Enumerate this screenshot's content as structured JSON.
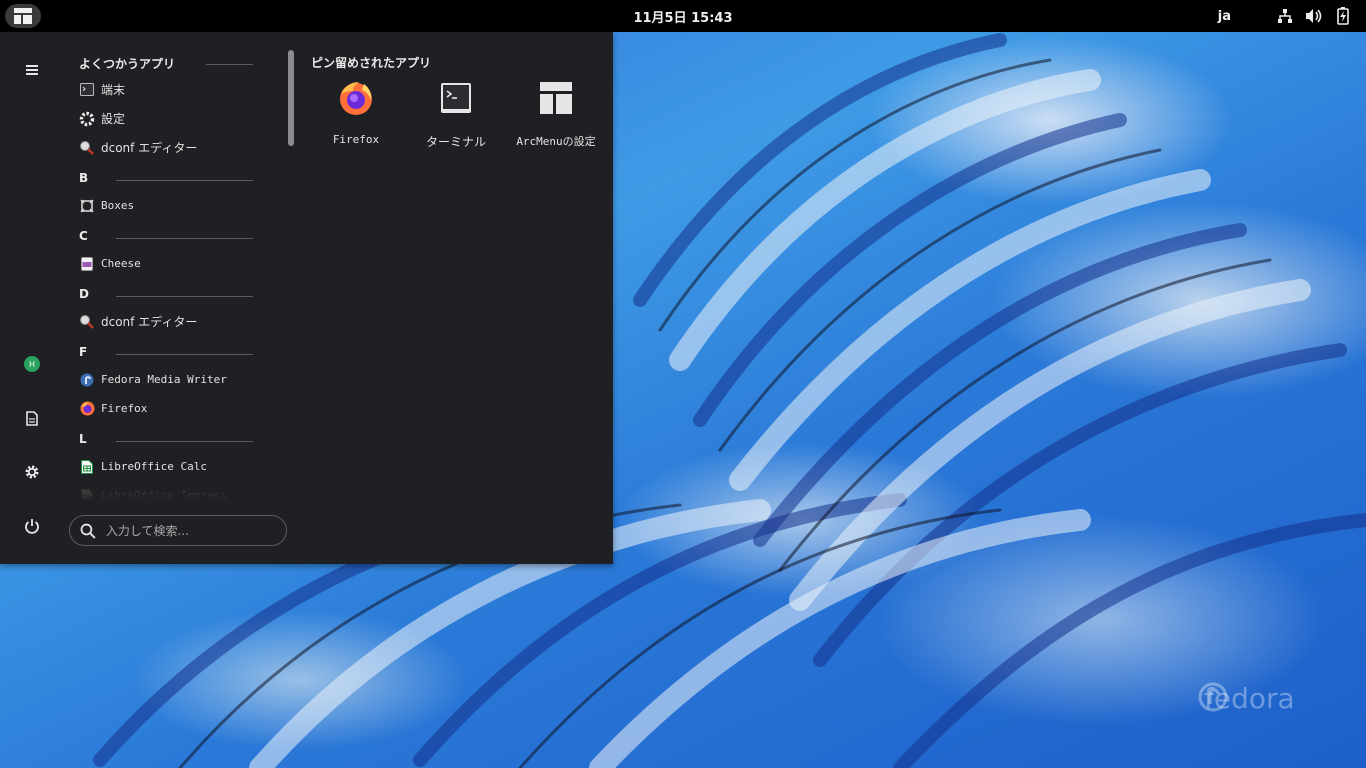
{
  "topbar": {
    "clock": "11月5日  15:43",
    "language": "ja",
    "tray_icons": [
      "network-icon",
      "volume-icon",
      "battery-charging-icon"
    ]
  },
  "sidebar": {
    "icons": [
      "hamburger-menu-icon",
      "user-avatar-icon",
      "documents-icon",
      "settings-gear-icon",
      "power-icon"
    ],
    "avatar_letter": "H",
    "avatar_color": "#2aa15e"
  },
  "apps": {
    "sections": [
      {
        "header": "よくつかうアプリ",
        "items": [
          {
            "name": "端末",
            "icon": "terminal-icon"
          },
          {
            "name": "設定",
            "icon": "settings-icon"
          },
          {
            "name": "dconf エディター",
            "icon": "dconf-editor-icon"
          }
        ]
      },
      {
        "header": "B",
        "items": [
          {
            "name": "Boxes",
            "icon": "boxes-icon"
          }
        ]
      },
      {
        "header": "C",
        "items": [
          {
            "name": "Cheese",
            "icon": "cheese-icon"
          }
        ]
      },
      {
        "header": "D",
        "items": [
          {
            "name": "dconf エディター",
            "icon": "dconf-editor-icon"
          }
        ]
      },
      {
        "header": "F",
        "items": [
          {
            "name": "Fedora Media Writer",
            "icon": "fedora-media-writer-icon"
          },
          {
            "name": "Firefox",
            "icon": "firefox-icon"
          }
        ]
      },
      {
        "header": "L",
        "items": [
          {
            "name": "LibreOffice Calc",
            "icon": "libreoffice-calc-icon"
          },
          {
            "name": "LibreOffice Impress",
            "icon": "libreoffice-impress-icon"
          }
        ]
      }
    ]
  },
  "pinned": {
    "title": "ピン留めされたアプリ",
    "items": [
      {
        "name": "Firefox",
        "icon": "firefox-icon"
      },
      {
        "name": "ターミナル",
        "icon": "terminal-icon"
      },
      {
        "name": "ArcMenuの設定",
        "icon": "arcmenu-settings-icon"
      }
    ]
  },
  "search": {
    "placeholder": "入力して検索..."
  },
  "wallpaper": {
    "brand": "fedora"
  },
  "colors": {
    "menu_bg": "#1e2023",
    "topbar_bg": "#000000",
    "accent": "#2aa15e"
  }
}
